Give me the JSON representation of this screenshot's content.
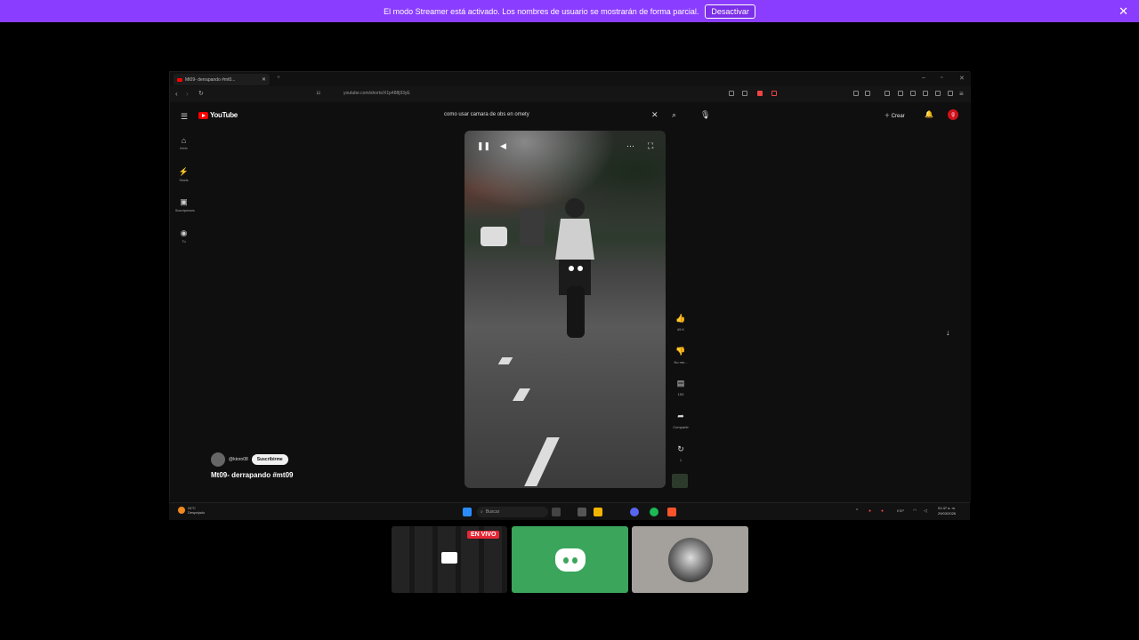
{
  "banner": {
    "text": "El modo Streamer está activado. Los nombres de usuario se mostrarán de forma parcial.",
    "button": "Desactivar",
    "close": "✕"
  },
  "browser": {
    "tab_title": "Mt09- derrapando #mt0...",
    "tab_close": "✕",
    "new_tab": "+",
    "url": "youtube.com/shorts/X1p488j93yE"
  },
  "youtube": {
    "logo": "YouTube",
    "search_value": "como usar camara de obs en omety",
    "create_label": "Crear",
    "avatar_letter": "g",
    "sidebar": [
      {
        "icon": "⌂",
        "label": "Inicio"
      },
      {
        "icon": "⚡",
        "label": "Shorts"
      },
      {
        "icon": "▣",
        "label": "Suscripciones"
      },
      {
        "icon": "◉",
        "label": "Tú"
      }
    ],
    "actions": {
      "like_count": "49 K",
      "dislike_label": "No me...",
      "comments_count": "153",
      "share_label": "Compartir",
      "remix_label": "1"
    },
    "channel_handle": "@ktoro08",
    "subscribe_label": "Suscribirme",
    "video_title": "Mt09- derrapando #mt09"
  },
  "taskbar": {
    "weather_temp": "24°C",
    "weather_desc": "Despejado",
    "search_placeholder": "Buscar",
    "lang": "ESP",
    "time": "01:47 a. m.",
    "date": "29/03/2026"
  },
  "overlay": {
    "live_badge": "EN VIVO"
  }
}
